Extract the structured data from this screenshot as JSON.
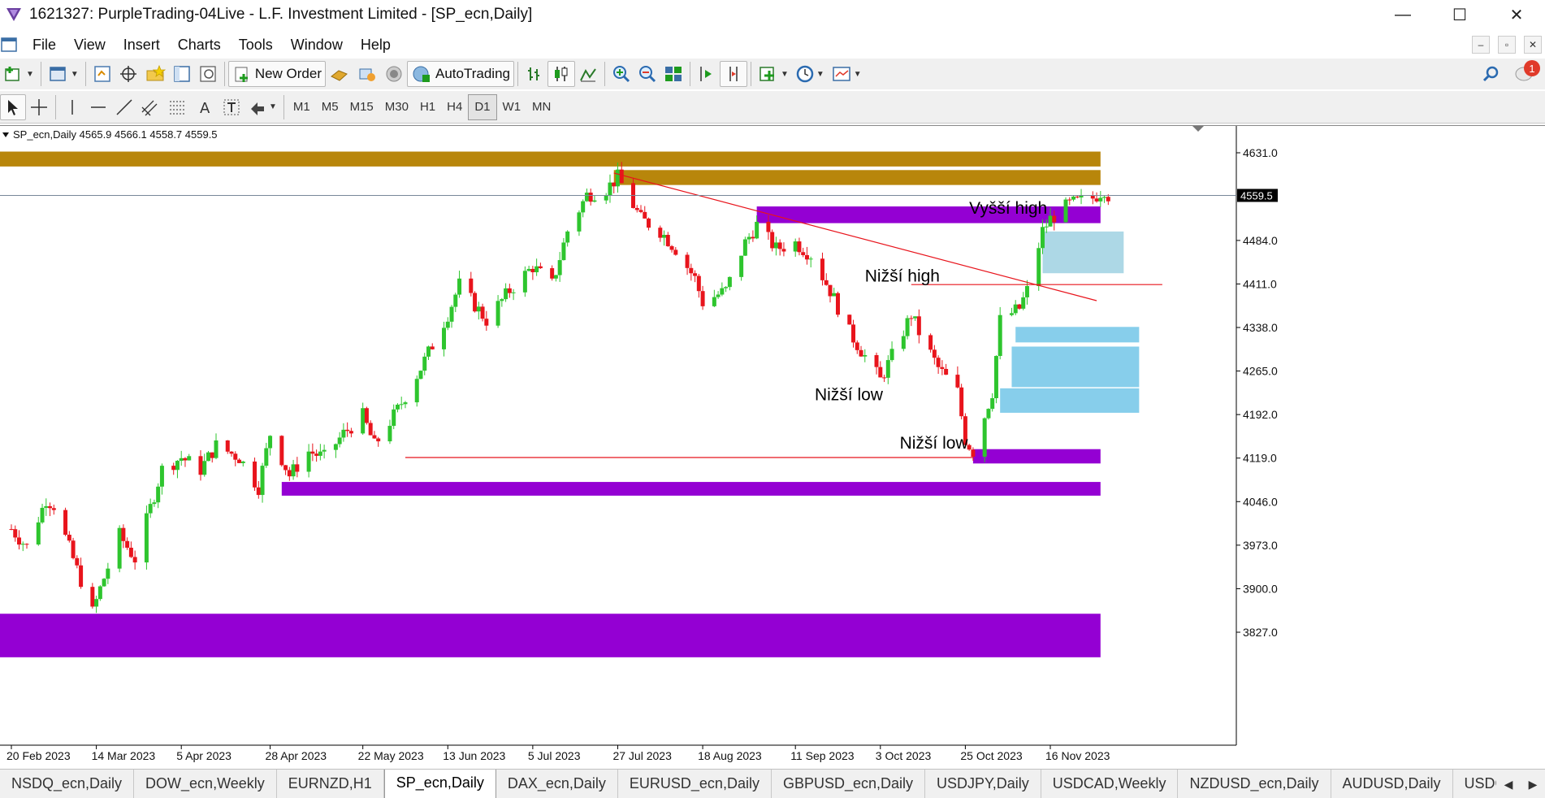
{
  "window": {
    "title": "1621327: PurpleTrading-04Live - L.F. Investment Limited - [SP_ecn,Daily]",
    "minimize": "—",
    "maximize": "☐",
    "close": "✕"
  },
  "menu": {
    "items": [
      "File",
      "View",
      "Insert",
      "Charts",
      "Tools",
      "Window",
      "Help"
    ],
    "mdi": [
      "–",
      "▫",
      "✕"
    ]
  },
  "toolbar": {
    "new_order_label": "New Order",
    "autotrading_label": "AutoTrading",
    "notification_count": "1"
  },
  "timeframes": [
    "M1",
    "M5",
    "M15",
    "M30",
    "H1",
    "H4",
    "D1",
    "W1",
    "MN"
  ],
  "active_timeframe": "D1",
  "chart": {
    "info": "SP_ecn,Daily  4565.9 4566.1 4558.7 4559.5",
    "current_price_label": "4559.5",
    "annotations": [
      "Vyšší high",
      "Nižší high",
      "Nižší low",
      "Nižší low"
    ],
    "colors": {
      "bull": "#2ec52e",
      "bear": "#e8141c",
      "zone_gold": "#b8860b",
      "zone_purple": "#9400d3",
      "zone_lightblue": "#87ceeb",
      "zone_paleblue": "#add8e6",
      "trendline": "#e8141c"
    }
  },
  "chart_data": {
    "type": "candlestick",
    "symbol": "SP_ecn",
    "timeframe": "Daily",
    "ohlc_last": {
      "open": 4565.9,
      "high": 4566.1,
      "low": 4558.7,
      "close": 4559.5
    },
    "y_ticks": [
      4631.0,
      4484.0,
      4411.0,
      4338.0,
      4265.0,
      4192.0,
      4119.0,
      4046.0,
      3973.0,
      3900.0,
      3827.0
    ],
    "x_ticks": [
      "20 Feb 2023",
      "14 Mar 2023",
      "5 Apr 2023",
      "28 Apr 2023",
      "22 May 2023",
      "13 Jun 2023",
      "5 Jul 2023",
      "27 Jul 2023",
      "18 Aug 2023",
      "11 Sep 2023",
      "3 Oct 2023",
      "25 Oct 2023",
      "16 Nov 2023"
    ],
    "ylim": [
      3790,
      4650
    ],
    "close_path": [
      [
        "20 Feb 2023",
        4000
      ],
      [
        "24 Feb 2023",
        3970
      ],
      [
        "1 Mar 2023",
        4050
      ],
      [
        "3 Mar 2023",
        4040
      ],
      [
        "8 Mar 2023",
        3950
      ],
      [
        "13 Mar 2023",
        3860
      ],
      [
        "15 Mar 2023",
        3900
      ],
      [
        "20 Mar 2023",
        3990
      ],
      [
        "24 Mar 2023",
        3950
      ],
      [
        "31 Mar 2023",
        4100
      ],
      [
        "5 Apr 2023",
        4120
      ],
      [
        "10 Apr 2023",
        4100
      ],
      [
        "14 Apr 2023",
        4140
      ],
      [
        "20 Apr 2023",
        4120
      ],
      [
        "25 Apr 2023",
        4070
      ],
      [
        "28 Apr 2023",
        4160
      ],
      [
        "3 May 2023",
        4090
      ],
      [
        "8 May 2023",
        4130
      ],
      [
        "12 May 2023",
        4120
      ],
      [
        "17 May 2023",
        4160
      ],
      [
        "22 May 2023",
        4190
      ],
      [
        "25 May 2023",
        4140
      ],
      [
        "31 May 2023",
        4200
      ],
      [
        "6 Jun 2023",
        4270
      ],
      [
        "13 Jun 2023",
        4360
      ],
      [
        "16 Jun 2023",
        4410
      ],
      [
        "23 Jun 2023",
        4350
      ],
      [
        "29 Jun 2023",
        4400
      ],
      [
        "5 Jul 2023",
        4440
      ],
      [
        "10 Jul 2023",
        4410
      ],
      [
        "14 Jul 2023",
        4500
      ],
      [
        "19 Jul 2023",
        4560
      ],
      [
        "24 Jul 2023",
        4570
      ],
      [
        "27 Jul 2023",
        4590
      ],
      [
        "2 Aug 2023",
        4520
      ],
      [
        "7 Aug 2023",
        4500
      ],
      [
        "11 Aug 2023",
        4470
      ],
      [
        "16 Aug 2023",
        4420
      ],
      [
        "18 Aug 2023",
        4380
      ],
      [
        "24 Aug 2023",
        4400
      ],
      [
        "29 Aug 2023",
        4480
      ],
      [
        "1 Sep 2023",
        4510
      ],
      [
        "6 Sep 2023",
        4470
      ],
      [
        "11 Sep 2023",
        4480
      ],
      [
        "15 Sep 2023",
        4460
      ],
      [
        "20 Sep 2023",
        4400
      ],
      [
        "25 Sep 2023",
        4330
      ],
      [
        "29 Sep 2023",
        4290
      ],
      [
        "3 Oct 2023",
        4250
      ],
      [
        "6 Oct 2023",
        4290
      ],
      [
        "11 Oct 2023",
        4360
      ],
      [
        "13 Oct 2023",
        4330
      ],
      [
        "18 Oct 2023",
        4270
      ],
      [
        "23 Oct 2023",
        4230
      ],
      [
        "25 Oct 2023",
        4150
      ],
      [
        "27 Oct 2023",
        4130
      ],
      [
        "1 Nov 2023",
        4230
      ],
      [
        "3 Nov 2023",
        4350
      ],
      [
        "8 Nov 2023",
        4370
      ],
      [
        "10 Nov 2023",
        4400
      ],
      [
        "14 Nov 2023",
        4500
      ],
      [
        "16 Nov 2023",
        4520
      ],
      [
        "21 Nov 2023",
        4545
      ],
      [
        "27 Nov 2023",
        4555
      ],
      [
        "30 Nov 2023",
        4570
      ],
      [
        "1 Dec 2023",
        4559.5
      ]
    ],
    "zones": [
      {
        "color": "gold",
        "from": "20 Feb 2023",
        "to": "29 Nov 2023",
        "low": 4608,
        "high": 4633
      },
      {
        "color": "gold",
        "from": "26 Jul 2023",
        "to": "29 Nov 2023",
        "low": 4577,
        "high": 4602
      },
      {
        "color": "purple",
        "from": "1 Sep 2023",
        "to": "29 Nov 2023",
        "low": 4513,
        "high": 4541
      },
      {
        "color": "paleblue",
        "from": "14 Nov 2023",
        "to": "5 Dec 2023",
        "low": 4429,
        "high": 4499
      },
      {
        "color": "lightblue",
        "from": "7 Nov 2023",
        "to": "9 Dec 2023",
        "low": 4313,
        "high": 4339
      },
      {
        "color": "lightblue",
        "from": "6 Nov 2023",
        "to": "9 Dec 2023",
        "low": 4238,
        "high": 4306
      },
      {
        "color": "lightblue",
        "from": "3 Nov 2023",
        "to": "9 Dec 2023",
        "low": 4195,
        "high": 4236
      },
      {
        "color": "purple",
        "from": "27 Oct 2023",
        "to": "29 Nov 2023",
        "low": 4110,
        "high": 4134
      },
      {
        "color": "purple",
        "from": "1 May 2023",
        "to": "29 Nov 2023",
        "low": 4056,
        "high": 4079
      },
      {
        "color": "purple",
        "from": "20 Feb 2023",
        "to": "29 Nov 2023",
        "low": 3785,
        "high": 3858
      }
    ],
    "lines": [
      {
        "from": [
          "26 Jul 2023",
          4597
        ],
        "to": [
          "28 Nov 2023",
          4383
        ]
      },
      {
        "from": [
          "11 Oct 2023",
          4410
        ],
        "to": [
          "15 Dec 2023",
          4410
        ]
      },
      {
        "from": [
          "2 Jun 2023",
          4120
        ],
        "to": [
          "27 Oct 2023",
          4120
        ]
      }
    ]
  }
}
